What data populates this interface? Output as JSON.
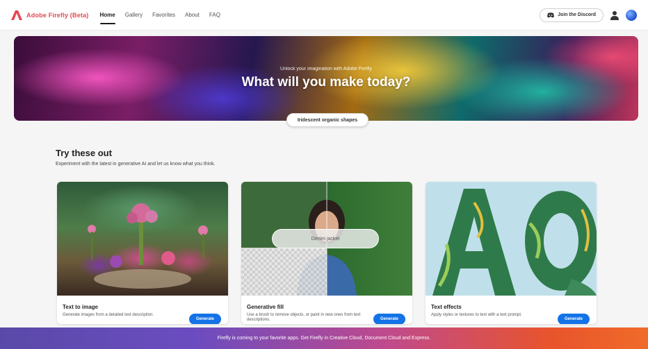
{
  "header": {
    "brand": "Adobe Firefly (Beta)",
    "nav": [
      {
        "label": "Home",
        "active": true
      },
      {
        "label": "Gallery",
        "active": false
      },
      {
        "label": "Favorites",
        "active": false
      },
      {
        "label": "About",
        "active": false
      },
      {
        "label": "FAQ",
        "active": false
      }
    ],
    "discord_label": "Join the Discord"
  },
  "hero": {
    "subtitle": "Unlock your imagination with Adobe Firefly",
    "title": "What will you make today?",
    "prompt_value": "Iridescent organic shapes"
  },
  "section": {
    "title": "Try these out",
    "description": "Experiment with the latest in generative AI and let us know what you think."
  },
  "cards": [
    {
      "title": "Text to image",
      "description": "Generate images from a detailed text description.",
      "button": "Generate"
    },
    {
      "title": "Generative fill",
      "description": "Use a brush to remove objects, or paint in new ones from text descriptions.",
      "button": "Generate",
      "overlay": "Denim jacket"
    },
    {
      "title": "Text effects",
      "description": "Apply styles or textures to text with a text prompt.",
      "button": "Generate"
    }
  ],
  "banner": {
    "text": "Firefly is coming to your favorite apps. Get Firefly in Creative Cloud, Document Cloud and Express."
  },
  "colors": {
    "accent": "#1473e6",
    "brand": "#e34850"
  }
}
